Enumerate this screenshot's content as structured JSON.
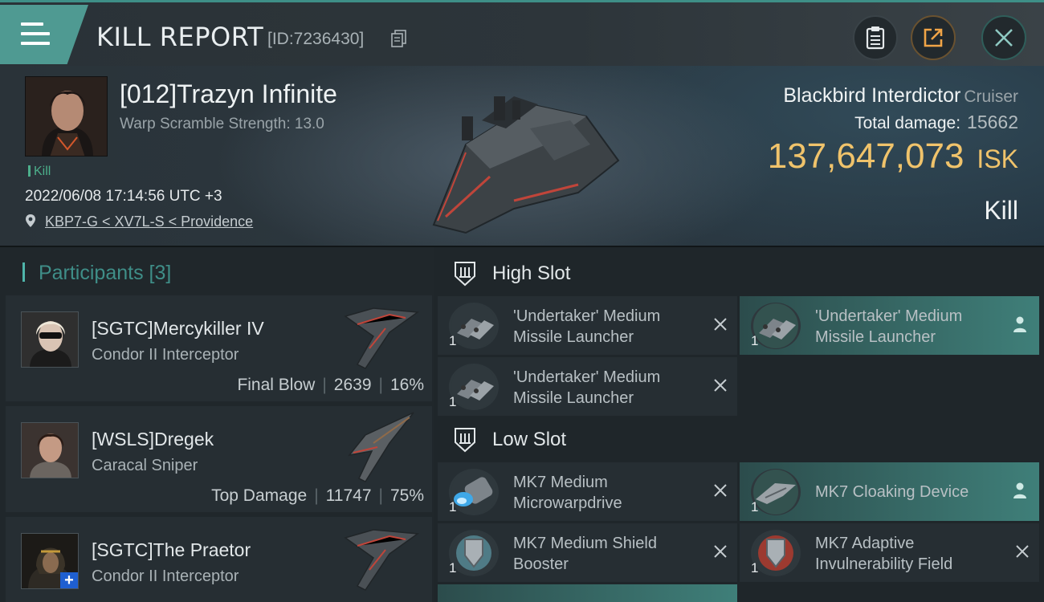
{
  "header": {
    "title": "KILL REPORT",
    "id_label": "[ID:7236430]"
  },
  "victim": {
    "name": "[012]Trazyn Infinite",
    "subtitle": "Warp Scramble Strength: 13.0",
    "tag": "Kill",
    "datetime": "2022/06/08 17:14:56 UTC +3",
    "location": "KBP7-G < XV7L-S < Providence",
    "ship_name": "Blackbird Interdictor",
    "ship_class": "Cruiser",
    "total_damage_label": "Total damage:",
    "total_damage": "15662",
    "isk_value": "137,647,073",
    "isk_unit": "ISK",
    "result": "Kill"
  },
  "participants": {
    "title": "Participants",
    "count": "[3]",
    "items": [
      {
        "name": "[SGTC]Mercykiller IV",
        "ship": "Condor II Interceptor",
        "role": "Final Blow",
        "damage": "2639",
        "percent": "16%"
      },
      {
        "name": "[WSLS]Dregek",
        "ship": "Caracal Sniper",
        "role": "Top Damage",
        "damage": "11747",
        "percent": "75%"
      },
      {
        "name": "[SGTC]The Praetor",
        "ship": "Condor II Interceptor",
        "role": "",
        "damage": "",
        "percent": ""
      }
    ]
  },
  "slots": {
    "high": {
      "label": "High Slot",
      "modules": [
        {
          "name": "'Undertaker' Medium Missile Launcher",
          "qty": "1",
          "state": "destroyed"
        },
        {
          "name": "'Undertaker' Medium Missile Launcher",
          "qty": "1",
          "state": "dropped"
        },
        {
          "name": "'Undertaker' Medium Missile Launcher",
          "qty": "1",
          "state": "destroyed"
        }
      ]
    },
    "low": {
      "label": "Low Slot",
      "modules": [
        {
          "name": "MK7 Medium Microwarpdrive",
          "qty": "1",
          "state": "destroyed"
        },
        {
          "name": "MK7 Cloaking Device",
          "qty": "1",
          "state": "dropped"
        },
        {
          "name": "MK7 Medium Shield Booster",
          "qty": "1",
          "state": "destroyed"
        },
        {
          "name": "MK7 Adaptive Invulnerability Field",
          "qty": "1",
          "state": "destroyed"
        }
      ]
    }
  },
  "colors": {
    "accent_teal": "#4f9a92",
    "isk_gold": "#f0c36b",
    "kill_green": "#4caf8b"
  }
}
